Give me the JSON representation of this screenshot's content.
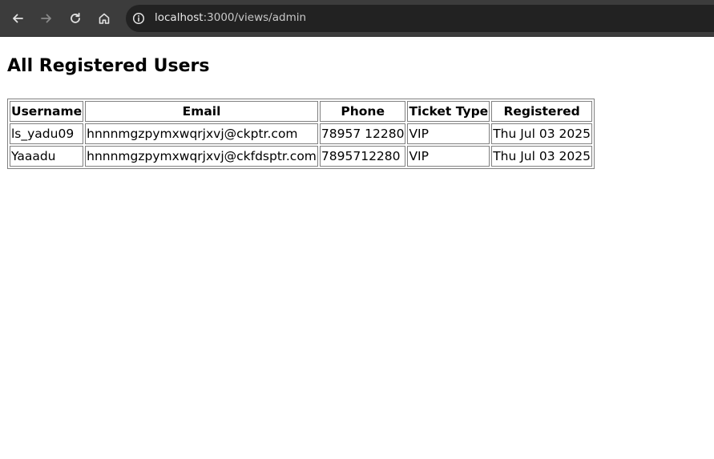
{
  "browser": {
    "url_host": "localhost",
    "url_path": ":3000/views/admin"
  },
  "page": {
    "title": "All Registered Users"
  },
  "table": {
    "headers": [
      "Username",
      "Email",
      "Phone",
      "Ticket Type",
      "Registered"
    ],
    "rows": [
      {
        "username": "ls_yadu09",
        "email": "hnnnmgzpymxwqrjxvj@ckptr.com",
        "phone": "78957 12280",
        "ticket_type": "VIP",
        "registered": "Thu Jul 03 2025"
      },
      {
        "username": "Yaaadu",
        "email": "hnnnmgzpymxwqrjxvj@ckfdsptr.com",
        "phone": "7895712280",
        "ticket_type": "VIP",
        "registered": "Thu Jul 03 2025"
      }
    ]
  }
}
